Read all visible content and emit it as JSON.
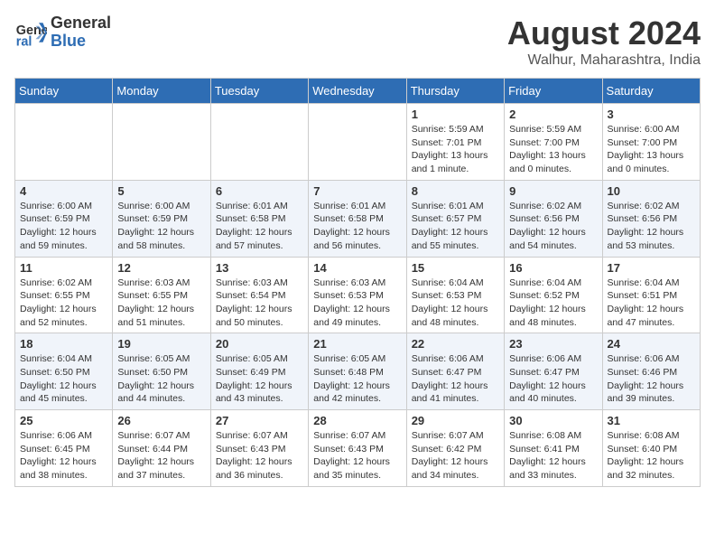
{
  "header": {
    "logo_line1": "General",
    "logo_line2": "Blue",
    "month_year": "August 2024",
    "location": "Walhur, Maharashtra, India"
  },
  "weekdays": [
    "Sunday",
    "Monday",
    "Tuesday",
    "Wednesday",
    "Thursday",
    "Friday",
    "Saturday"
  ],
  "weeks": [
    [
      {
        "day": "",
        "info": ""
      },
      {
        "day": "",
        "info": ""
      },
      {
        "day": "",
        "info": ""
      },
      {
        "day": "",
        "info": ""
      },
      {
        "day": "1",
        "info": "Sunrise: 5:59 AM\nSunset: 7:01 PM\nDaylight: 13 hours\nand 1 minute."
      },
      {
        "day": "2",
        "info": "Sunrise: 5:59 AM\nSunset: 7:00 PM\nDaylight: 13 hours\nand 0 minutes."
      },
      {
        "day": "3",
        "info": "Sunrise: 6:00 AM\nSunset: 7:00 PM\nDaylight: 13 hours\nand 0 minutes."
      }
    ],
    [
      {
        "day": "4",
        "info": "Sunrise: 6:00 AM\nSunset: 6:59 PM\nDaylight: 12 hours\nand 59 minutes."
      },
      {
        "day": "5",
        "info": "Sunrise: 6:00 AM\nSunset: 6:59 PM\nDaylight: 12 hours\nand 58 minutes."
      },
      {
        "day": "6",
        "info": "Sunrise: 6:01 AM\nSunset: 6:58 PM\nDaylight: 12 hours\nand 57 minutes."
      },
      {
        "day": "7",
        "info": "Sunrise: 6:01 AM\nSunset: 6:58 PM\nDaylight: 12 hours\nand 56 minutes."
      },
      {
        "day": "8",
        "info": "Sunrise: 6:01 AM\nSunset: 6:57 PM\nDaylight: 12 hours\nand 55 minutes."
      },
      {
        "day": "9",
        "info": "Sunrise: 6:02 AM\nSunset: 6:56 PM\nDaylight: 12 hours\nand 54 minutes."
      },
      {
        "day": "10",
        "info": "Sunrise: 6:02 AM\nSunset: 6:56 PM\nDaylight: 12 hours\nand 53 minutes."
      }
    ],
    [
      {
        "day": "11",
        "info": "Sunrise: 6:02 AM\nSunset: 6:55 PM\nDaylight: 12 hours\nand 52 minutes."
      },
      {
        "day": "12",
        "info": "Sunrise: 6:03 AM\nSunset: 6:55 PM\nDaylight: 12 hours\nand 51 minutes."
      },
      {
        "day": "13",
        "info": "Sunrise: 6:03 AM\nSunset: 6:54 PM\nDaylight: 12 hours\nand 50 minutes."
      },
      {
        "day": "14",
        "info": "Sunrise: 6:03 AM\nSunset: 6:53 PM\nDaylight: 12 hours\nand 49 minutes."
      },
      {
        "day": "15",
        "info": "Sunrise: 6:04 AM\nSunset: 6:53 PM\nDaylight: 12 hours\nand 48 minutes."
      },
      {
        "day": "16",
        "info": "Sunrise: 6:04 AM\nSunset: 6:52 PM\nDaylight: 12 hours\nand 48 minutes."
      },
      {
        "day": "17",
        "info": "Sunrise: 6:04 AM\nSunset: 6:51 PM\nDaylight: 12 hours\nand 47 minutes."
      }
    ],
    [
      {
        "day": "18",
        "info": "Sunrise: 6:04 AM\nSunset: 6:50 PM\nDaylight: 12 hours\nand 45 minutes."
      },
      {
        "day": "19",
        "info": "Sunrise: 6:05 AM\nSunset: 6:50 PM\nDaylight: 12 hours\nand 44 minutes."
      },
      {
        "day": "20",
        "info": "Sunrise: 6:05 AM\nSunset: 6:49 PM\nDaylight: 12 hours\nand 43 minutes."
      },
      {
        "day": "21",
        "info": "Sunrise: 6:05 AM\nSunset: 6:48 PM\nDaylight: 12 hours\nand 42 minutes."
      },
      {
        "day": "22",
        "info": "Sunrise: 6:06 AM\nSunset: 6:47 PM\nDaylight: 12 hours\nand 41 minutes."
      },
      {
        "day": "23",
        "info": "Sunrise: 6:06 AM\nSunset: 6:47 PM\nDaylight: 12 hours\nand 40 minutes."
      },
      {
        "day": "24",
        "info": "Sunrise: 6:06 AM\nSunset: 6:46 PM\nDaylight: 12 hours\nand 39 minutes."
      }
    ],
    [
      {
        "day": "25",
        "info": "Sunrise: 6:06 AM\nSunset: 6:45 PM\nDaylight: 12 hours\nand 38 minutes."
      },
      {
        "day": "26",
        "info": "Sunrise: 6:07 AM\nSunset: 6:44 PM\nDaylight: 12 hours\nand 37 minutes."
      },
      {
        "day": "27",
        "info": "Sunrise: 6:07 AM\nSunset: 6:43 PM\nDaylight: 12 hours\nand 36 minutes."
      },
      {
        "day": "28",
        "info": "Sunrise: 6:07 AM\nSunset: 6:43 PM\nDaylight: 12 hours\nand 35 minutes."
      },
      {
        "day": "29",
        "info": "Sunrise: 6:07 AM\nSunset: 6:42 PM\nDaylight: 12 hours\nand 34 minutes."
      },
      {
        "day": "30",
        "info": "Sunrise: 6:08 AM\nSunset: 6:41 PM\nDaylight: 12 hours\nand 33 minutes."
      },
      {
        "day": "31",
        "info": "Sunrise: 6:08 AM\nSunset: 6:40 PM\nDaylight: 12 hours\nand 32 minutes."
      }
    ]
  ]
}
